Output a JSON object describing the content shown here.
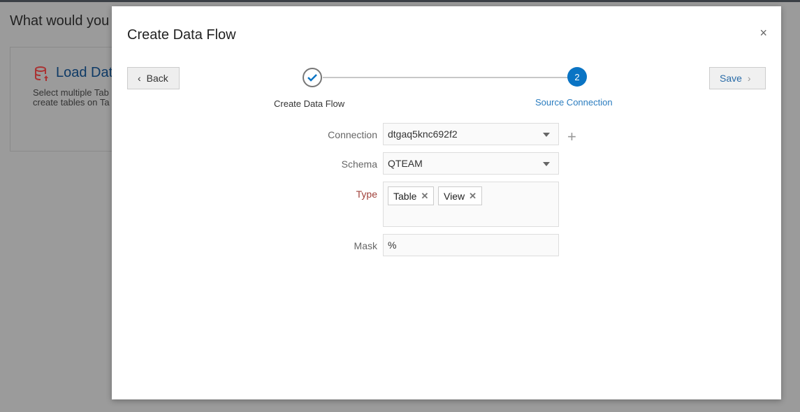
{
  "background": {
    "heading": "What would you",
    "card_title": "Load Dat",
    "card_desc_line1": "Select multiple Tab",
    "card_desc_line2": "create tables on Ta"
  },
  "modal": {
    "title": "Create Data Flow",
    "close": "×",
    "back_label": "Back",
    "save_label": "Save",
    "steps": [
      {
        "number": "1",
        "label": "Create Data Flow",
        "state": "completed"
      },
      {
        "number": "2",
        "label": "Source Connection",
        "state": "active"
      }
    ],
    "form": {
      "connection_label": "Connection",
      "connection_value": "dtgaq5knc692f2",
      "schema_label": "Schema",
      "schema_value": "QTEAM",
      "type_label": "Type",
      "type_tags": [
        "Table",
        "View"
      ],
      "mask_label": "Mask",
      "mask_value": "%",
      "add_icon": "+"
    }
  },
  "colors": {
    "accent": "#0a74c4",
    "required_label": "#a0413a"
  }
}
